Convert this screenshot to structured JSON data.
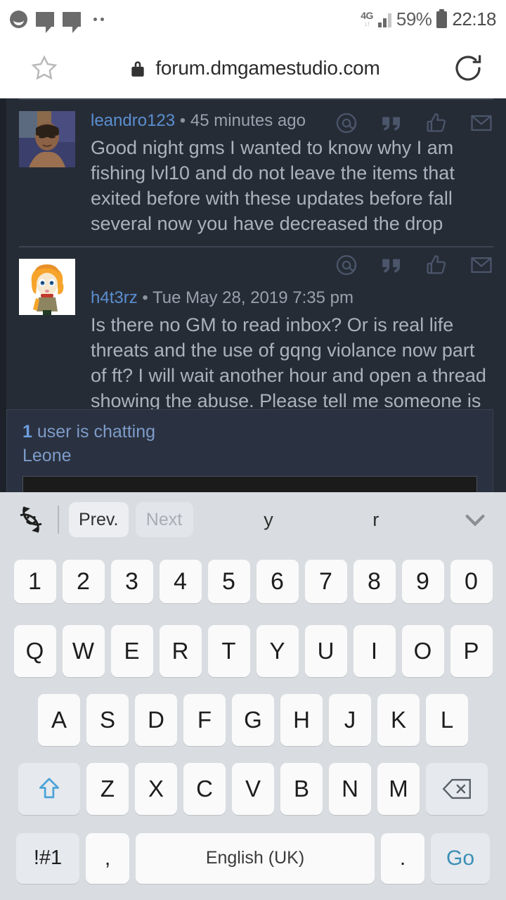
{
  "status_bar": {
    "icons": [
      "smiley-icon",
      "chat-bubble-icon",
      "chat-bubble-icon",
      "more-dots-icon"
    ],
    "network": "4G",
    "data_arrows": "↓↑",
    "battery_percent": "59%",
    "time": "22:18"
  },
  "browser": {
    "url": "forum.dmgamestudio.com",
    "bookmark_icon": "star-icon",
    "security_icon": "lock-icon",
    "reload_icon": "reload-icon"
  },
  "forum": {
    "post_actions": [
      "mention-icon",
      "quote-icon",
      "like-icon",
      "message-icon"
    ],
    "posts": [
      {
        "author": "leandro123",
        "separator": "•",
        "time": "45 minutes ago",
        "text": "Good night gms I wanted to know why I am fishing lvl10 and do not leave the items that exited before with these updates before fall several now you have decreased the drop",
        "avatar": "photo-avatar"
      },
      {
        "author": "h4t3rz",
        "separator": "•",
        "time": "Tue May 28, 2019 7:35 pm",
        "text": "Is there no GM to read inbox? Or is real life threats and the use of gqng violance now part of ft? I will wait another hour and open a thread showing the abuse. Please tell me someone is",
        "avatar": "cartoon-avatar"
      }
    ]
  },
  "chat": {
    "count": "1",
    "count_label": "user is chatting",
    "users": "Leone",
    "input_value": ""
  },
  "keyboard": {
    "toolbar": {
      "emoji_icon": "emoji-rotate-icon",
      "prev_label": "Prev.",
      "next_label": "Next",
      "suggestions": [
        "y",
        "r"
      ],
      "collapse_icon": "chevron-down-icon"
    },
    "rows": {
      "numbers": [
        "1",
        "2",
        "3",
        "4",
        "5",
        "6",
        "7",
        "8",
        "9",
        "0"
      ],
      "top": [
        "Q",
        "W",
        "E",
        "R",
        "T",
        "Y",
        "U",
        "I",
        "O",
        "P"
      ],
      "home": [
        "A",
        "S",
        "D",
        "F",
        "G",
        "H",
        "J",
        "K",
        "L"
      ],
      "bottom": [
        "Z",
        "X",
        "C",
        "V",
        "B",
        "N",
        "M"
      ],
      "shift_icon": "shift-icon",
      "backspace_icon": "backspace-icon"
    },
    "bottom_row": {
      "symbols": "!#1",
      "comma": ",",
      "space": "English (UK)",
      "period": ".",
      "go": "Go"
    }
  },
  "colors": {
    "accent_blue": "#5a8fd1",
    "page_bg": "#262c36",
    "keyboard_bg": "#d9dce0",
    "key_blue": "#3a8fb7"
  }
}
